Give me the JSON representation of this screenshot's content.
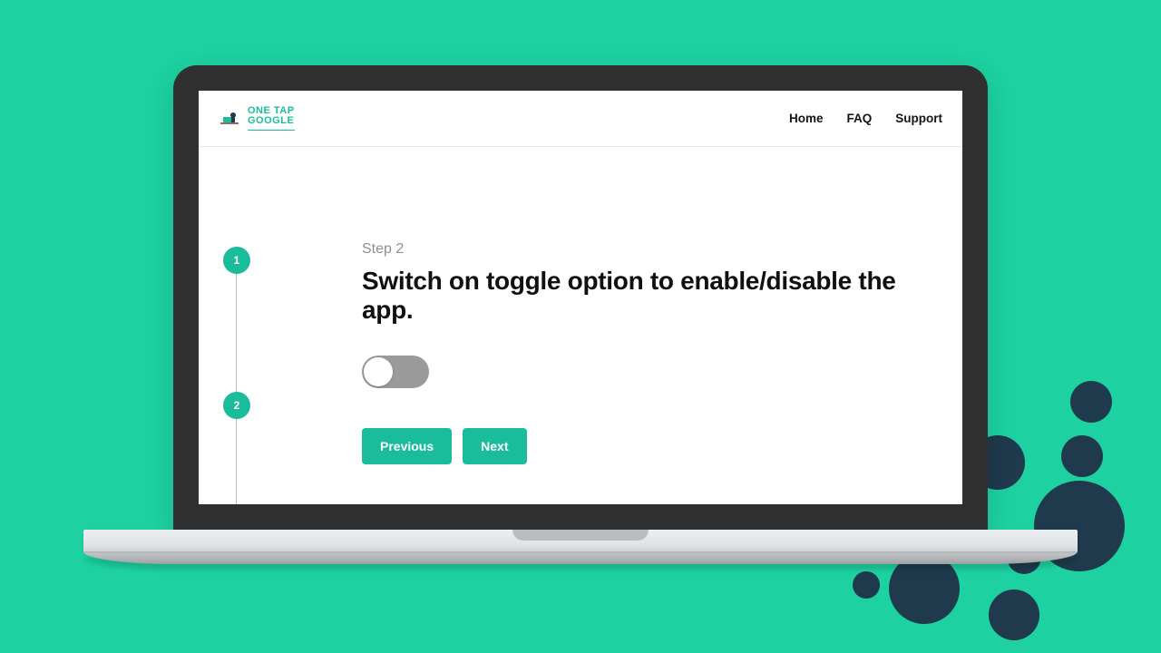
{
  "logo": {
    "line1": "ONE TAP",
    "line2": "GOOGLE"
  },
  "nav": {
    "home": "Home",
    "faq": "FAQ",
    "support": "Support"
  },
  "stepper": {
    "step1": "1",
    "step2": "2"
  },
  "content": {
    "step_label": "Step 2",
    "instruction": "Switch on toggle option to enable/disable the app."
  },
  "buttons": {
    "previous": "Previous",
    "next": "Next"
  },
  "toggle": {
    "state": "off"
  },
  "colors": {
    "brand": "#1bbc9b",
    "background": "#1dd1a1",
    "dark_accent": "#1e3a4c"
  }
}
